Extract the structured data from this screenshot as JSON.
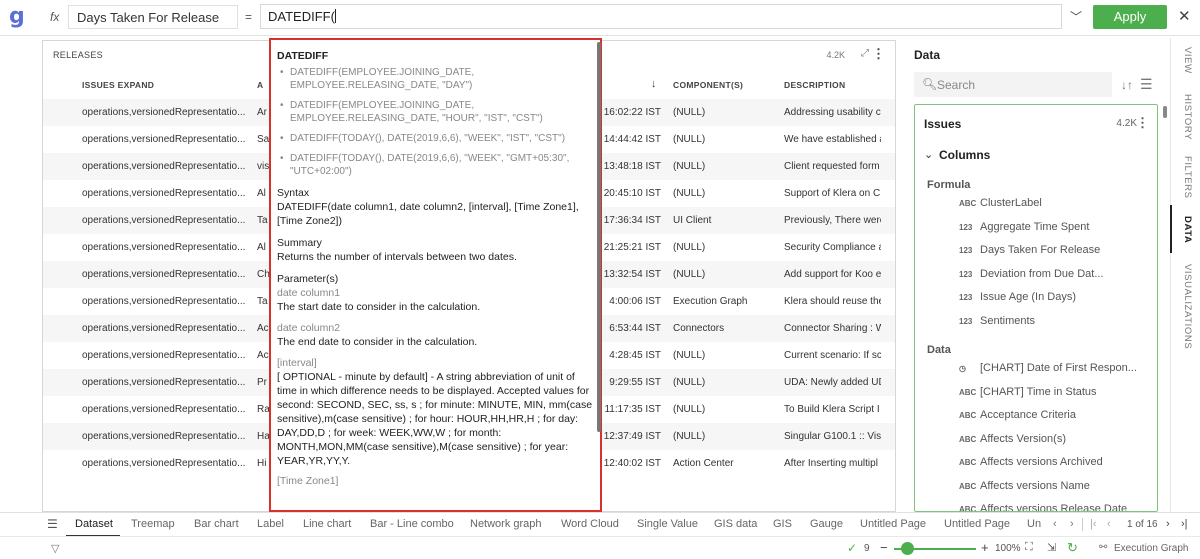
{
  "topbar": {
    "logo": "g",
    "fx": "fx",
    "column_name": "Days Taken For Release",
    "equals": "=",
    "formula": "DATEDIFF(",
    "apply": "Apply",
    "close": "✕"
  },
  "grid": {
    "title": "RELEASES",
    "count": "4.2K",
    "headers": {
      "c1": "ISSUES EXPAND",
      "c2": "A",
      "c3": "↓",
      "c4": "COMPONENT(S)",
      "c5": "DESCRIPTION"
    },
    "rows": [
      {
        "c1": "operations,versionedRepresentatio...",
        "c2": "Ar",
        "c3": "16:02:22 IST",
        "c4": "(NULL)",
        "c5": "Addressing usability c"
      },
      {
        "c1": "operations,versionedRepresentatio...",
        "c2": "Sa",
        "c3": "14:44:42 IST",
        "c4": "(NULL)",
        "c5": "We have established a"
      },
      {
        "c1": "operations,versionedRepresentatio...",
        "c2": "vis",
        "c3": "13:48:18 IST",
        "c4": "(NULL)",
        "c5": "Client requested form"
      },
      {
        "c1": "operations,versionedRepresentatio...",
        "c2": "Al",
        "c3": "20:45:10 IST",
        "c4": "(NULL)",
        "c5": "Support of Klera on C"
      },
      {
        "c1": "operations,versionedRepresentatio...",
        "c2": "Ta",
        "c3": "17:36:34 IST",
        "c4": "UI Client",
        "c5": "Previously, There were"
      },
      {
        "c1": "operations,versionedRepresentatio...",
        "c2": "Al",
        "c3": "21:25:21 IST",
        "c4": "(NULL)",
        "c5": "Security Compliance a"
      },
      {
        "c1": "operations,versionedRepresentatio...",
        "c2": "Ch",
        "c3": "13:32:54 IST",
        "c4": "(NULL)",
        "c5": "Add support for Koo e"
      },
      {
        "c1": "operations,versionedRepresentatio...",
        "c2": "Ta",
        "c3": "4:00:06 IST",
        "c4": "Execution Graph",
        "c5": "Klera should reuse the"
      },
      {
        "c1": "operations,versionedRepresentatio...",
        "c2": "Ac",
        "c3": "6:53:44 IST",
        "c4": "Connectors",
        "c5": "Connector Sharing : W"
      },
      {
        "c1": "operations,versionedRepresentatio...",
        "c2": "Ac",
        "c3": "4:28:45 IST",
        "c4": "(NULL)",
        "c5": "Current scenario: If sc"
      },
      {
        "c1": "operations,versionedRepresentatio...",
        "c2": "Pr",
        "c3": "9:29:55 IST",
        "c4": "(NULL)",
        "c5": "UDA: Newly added UD"
      },
      {
        "c1": "operations,versionedRepresentatio...",
        "c2": "Ra",
        "c3": "11:17:35 IST",
        "c4": "(NULL)",
        "c5": "To Build Klera Script I"
      },
      {
        "c1": "operations,versionedRepresentatio...",
        "c2": "Ha",
        "c3": "12:37:49 IST",
        "c4": "(NULL)",
        "c5": "Singular G100.1 :: Vis"
      },
      {
        "c1": "operations,versionedRepresentatio...",
        "c2": "Hi",
        "c3": "12:40:02 IST",
        "c4": "Action Center",
        "c5": "After Inserting multipl"
      }
    ]
  },
  "popup": {
    "title": "DATEDIFF",
    "examples": [
      "DATEDIFF(EMPLOYEE.JOINING_DATE, EMPLOYEE.RELEASING_DATE, \"DAY\")",
      "DATEDIFF(EMPLOYEE.JOINING_DATE, EMPLOYEE.RELEASING_DATE, \"HOUR\", \"IST\", \"CST\")",
      "DATEDIFF(TODAY(), DATE(2019,6,6), \"WEEK\", \"IST\", \"CST\")",
      "DATEDIFF(TODAY(), DATE(2019,6,6), \"WEEK\", \"GMT+05:30\", \"UTC+02:00\")"
    ],
    "syntax_label": "Syntax",
    "syntax": "DATEDIFF(date column1, date column2, [interval], [Time Zone1], [Time Zone2])",
    "summary_label": "Summary",
    "summary": "Returns the number of intervals between two dates.",
    "params_label": "Parameter(s)",
    "p1_name": "date column1",
    "p1_desc": "The start date to consider in the calculation.",
    "p2_name": "date column2",
    "p2_desc": "The end date to consider in the calculation.",
    "p3_name": "[interval]",
    "p3_desc": "[ OPTIONAL - minute by default] - A string abbreviation of unit of time in which difference needs to be displayed. Accepted values for second: SECOND, SEC, ss, s ; for minute: MINUTE, MIN, mm(case sensitive),m(case sensitive) ; for hour: HOUR,HH,HR,H ; for day: DAY,DD,D ; for week: WEEK,WW,W ; for month: MONTH,MON,MM(case sensitive),M(case sensitive) ; for year: YEAR,YR,YY,Y.",
    "p4_name": "[Time Zone1]"
  },
  "data_panel": {
    "title": "Data",
    "search_placeholder": "Search",
    "issues": "Issues",
    "issues_count": "4.2K",
    "columns": "Columns",
    "formula_group": "Formula",
    "formula_items": [
      {
        "type": "ABC",
        "label": "ClusterLabel"
      },
      {
        "type": "123",
        "label": "Aggregate Time Spent"
      },
      {
        "type": "123",
        "label": "Days Taken For Release"
      },
      {
        "type": "123",
        "label": "Deviation from Due Dat..."
      },
      {
        "type": "123",
        "label": "Issue Age (In Days)"
      },
      {
        "type": "123",
        "label": "Sentiments"
      }
    ],
    "data_group": "Data",
    "data_items": [
      {
        "type": "◷",
        "label": "[CHART] Date of First Respon..."
      },
      {
        "type": "ABC",
        "label": "[CHART] Time in Status"
      },
      {
        "type": "ABC",
        "label": "Acceptance Criteria"
      },
      {
        "type": "ABC",
        "label": "Affects Version(s)"
      },
      {
        "type": "ABC",
        "label": "Affects versions Archived"
      },
      {
        "type": "ABC",
        "label": "Affects versions Name"
      },
      {
        "type": "ABC",
        "label": "Affects versions Release Date"
      }
    ]
  },
  "vtabs": [
    "VIEW",
    "HISTORY",
    "FILTERS",
    "DATA",
    "VISUALIZATIONS"
  ],
  "bottom_tabs": [
    "Dataset",
    "Treemap",
    "Bar chart",
    "Label",
    "Line chart",
    "Bar - Line combo",
    "Network graph",
    "Word Cloud",
    "Single Value",
    "GIS data",
    "GIS",
    "Gauge",
    "Untitled Page",
    "Untitled Page",
    "Un"
  ],
  "pager": {
    "text": "1 of 16"
  },
  "status": {
    "ok_count": "9",
    "zoom": "100%",
    "zoom_level": 0.16,
    "exec": "Execution Graph"
  }
}
